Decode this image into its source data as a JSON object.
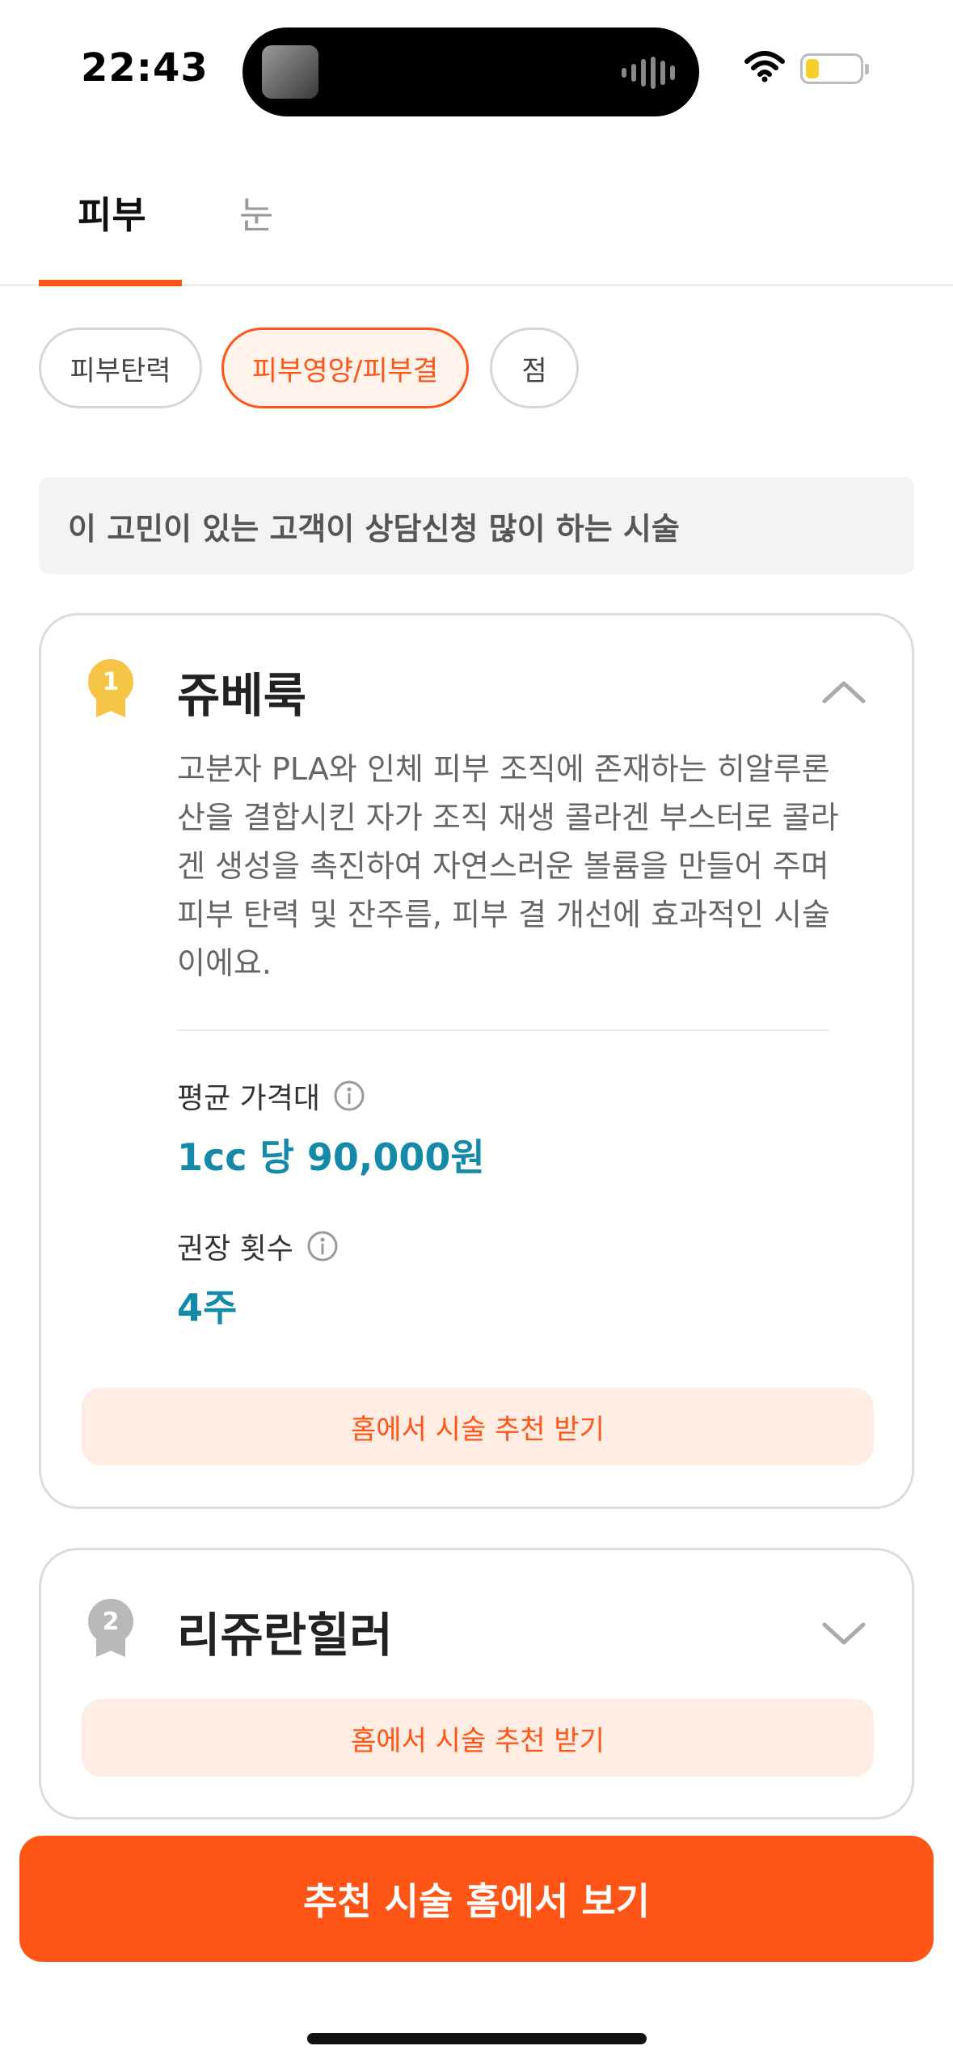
{
  "status_bar": {
    "time": "22:43"
  },
  "tabs": [
    {
      "label": "피부",
      "active": true
    },
    {
      "label": "눈",
      "active": false
    }
  ],
  "chips": [
    {
      "label": "피부탄력",
      "selected": false
    },
    {
      "label": "피부영양/피부결",
      "selected": true
    },
    {
      "label": "점",
      "selected": false
    }
  ],
  "info_bar": {
    "text": "이 고민이 있는 고객이 상담신청 많이 하는 시술"
  },
  "cards": [
    {
      "rank": "1",
      "title": "쥬베룩",
      "expanded": true,
      "description": "고분자 PLA와 인체 피부 조직에 존재하는 히알루론산을 결합시킨 자가 조직 재생 콜라겐 부스터로 콜라겐 생성을 촉진하여 자연스러운 볼륨을 만들어 주며 피부 탄력 및 잔주름, 피부 결 개선에 효과적인 시술이에요.",
      "price_label": "평균 가격대",
      "price_value": "1cc 당 90,000원",
      "count_label": "권장 횟수",
      "count_value": "4주",
      "button": "홈에서 시술 추천 받기"
    },
    {
      "rank": "2",
      "title": "리쥬란힐러",
      "expanded": false,
      "button": "홈에서 시술 추천 받기"
    }
  ],
  "cta": {
    "label": "추천 시술 홈에서 보기"
  },
  "colors": {
    "accent": "#ff5516",
    "value_blue": "#1589a8",
    "gold_medal": "#f7c545",
    "silver_medal": "#b8b8b8"
  }
}
